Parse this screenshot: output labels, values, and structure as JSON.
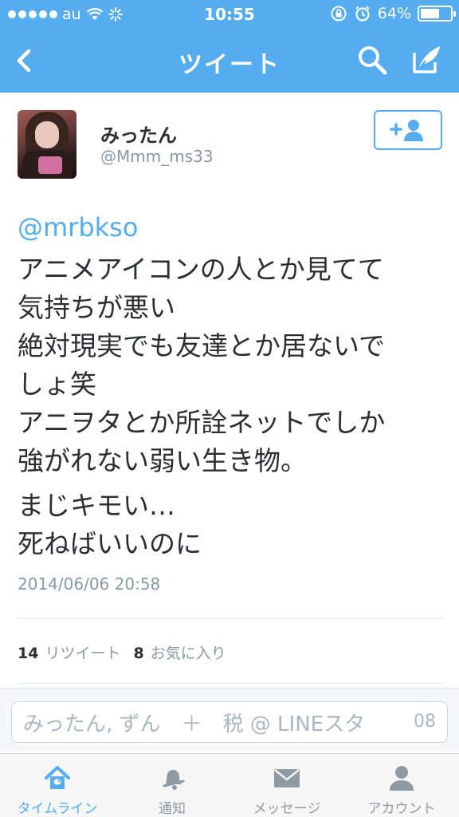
{
  "status_bar": {
    "carrier": "au",
    "time": "10:55",
    "battery": "64%",
    "battery_level": 0.64
  },
  "nav": {
    "title": "ツイート",
    "back_icon": "chevron-left-icon",
    "search_icon": "search-icon",
    "compose_icon": "compose-icon"
  },
  "tweet": {
    "author_name": "みったん",
    "author_handle": "@Mmm_ms33",
    "follow_icon": "add-user-icon",
    "mention": "@mrbkso",
    "paragraphs": [
      "アニメアイコンの人とか見てて\n気持ちが悪い",
      "絶対現実でも友達とか居ないで\nしょ笑",
      "アニヲタとか所詮ネットでしか\n強がれない弱い生き物。",
      "まじキモい…\n死ねばいいのに"
    ],
    "timestamp": "2014/06/06 20:58",
    "retweet_count": "14",
    "retweet_label": "リツイート",
    "favorite_count": "8",
    "favorite_label": "お気に入り"
  },
  "reply": {
    "text": "みったん, ずん　＋　税 @ LINEスタ",
    "counter": "08"
  },
  "tabs": [
    {
      "label": "タイムライン",
      "icon": "home-icon",
      "active": true
    },
    {
      "label": "通知",
      "icon": "bell-icon",
      "active": false
    },
    {
      "label": "メッセージ",
      "icon": "envelope-icon",
      "active": false
    },
    {
      "label": "アカウント",
      "icon": "person-icon",
      "active": false
    }
  ],
  "colors": {
    "brand_blue": "#55acee",
    "text_dark": "#292f33",
    "text_muted": "#8899a6"
  }
}
